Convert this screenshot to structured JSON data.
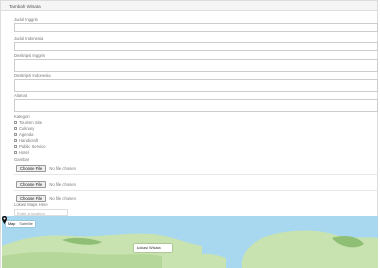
{
  "header": {
    "title": "Tambah Wisata"
  },
  "form": {
    "judul_inggris": {
      "label": "Judul Inggris",
      "value": ""
    },
    "judul_indonesia": {
      "label": "Judul Indonesia",
      "value": ""
    },
    "deskripsi_inggris": {
      "label": "Deskripsi Inggris",
      "value": ""
    },
    "deskripsi_indonesia": {
      "label": "Deskripsi Indonesia",
      "value": ""
    },
    "alamat": {
      "label": "Alamat",
      "value": ""
    },
    "kategori": {
      "label": "Kategori",
      "options": [
        "Tourism Site",
        "Culinary",
        "Agenda",
        "Handicraft",
        "Public Service",
        "Hotel"
      ]
    },
    "gambar": {
      "label": "Gambar",
      "button_label": "Choose File",
      "status": "No file chosen"
    },
    "lokasi": {
      "label": "Lokasi Maps Here",
      "search_placeholder": "Enter a location"
    }
  },
  "map": {
    "type_buttons": [
      "Map",
      "Satellite"
    ],
    "info_window_text": "Lokasi Wisata",
    "info_window_close": "×",
    "colors": {
      "water": "#a8d8f0",
      "land": "#c9e3b0",
      "land_dark": "#8fbf75"
    }
  }
}
